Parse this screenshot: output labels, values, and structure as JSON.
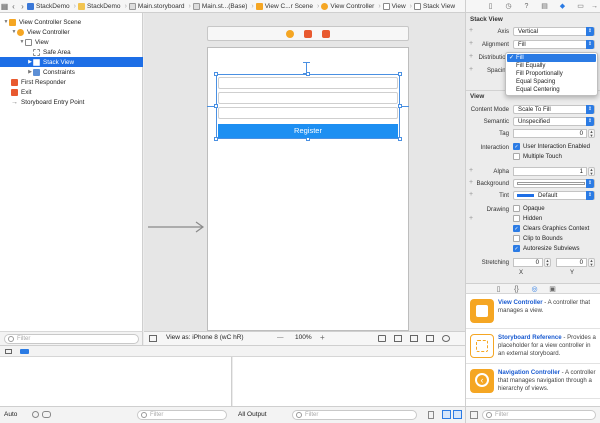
{
  "jumpbar": {
    "crumbs": [
      "StackDemo",
      "StackDemo",
      "Main.storyboard",
      "Main.st...(Base)",
      "View C...r Scene",
      "View Controller",
      "View",
      "Stack View"
    ]
  },
  "outline": {
    "items": [
      {
        "label": "View Controller Scene",
        "icon": "scene-icon"
      },
      {
        "label": "View Controller",
        "icon": "view-controller-icon"
      },
      {
        "label": "View",
        "icon": "view-icon"
      },
      {
        "label": "Safe Area",
        "icon": "safe-area-icon"
      },
      {
        "label": "Stack View",
        "icon": "stack-view-icon"
      },
      {
        "label": "Constraints",
        "icon": "constraints-icon"
      },
      {
        "label": "First Responder",
        "icon": "first-responder-icon"
      },
      {
        "label": "Exit",
        "icon": "exit-icon"
      },
      {
        "label": "Storyboard Entry Point",
        "icon": "arrow-right-icon"
      }
    ],
    "filter_placeholder": "Filter"
  },
  "canvas": {
    "button_label": "Register",
    "view_as": "View as: iPhone 8 (wC hR)",
    "zoom": "100%",
    "zoom_minus": "—",
    "zoom_plus": "+"
  },
  "inspector": {
    "stack_view": {
      "title": "Stack View",
      "axis_label": "Axis",
      "axis_value": "Vertical",
      "alignment_label": "Alignment",
      "alignment_value": "Fill",
      "distribution_label": "Distribution",
      "spacing_label": "Spacing",
      "menu": [
        "Fill",
        "Fill Equally",
        "Fill Proportionally",
        "Equal Spacing",
        "Equal Centering"
      ],
      "menu_selected": "Fill"
    },
    "view": {
      "title": "View",
      "content_mode_label": "Content Mode",
      "content_mode_value": "Scale To Fill",
      "semantic_label": "Semantic",
      "semantic_value": "Unspecified",
      "tag_label": "Tag",
      "tag_value": "0",
      "interaction_label": "Interaction",
      "user_interaction": "User Interaction Enabled",
      "multiple_touch": "Multiple Touch",
      "alpha_label": "Alpha",
      "alpha_value": "1",
      "background_label": "Background",
      "tint_label": "Tint",
      "tint_value": "Default",
      "drawing_label": "Drawing",
      "opaque": "Opaque",
      "hidden": "Hidden",
      "clears_graphics": "Clears Graphics Context",
      "clip_to_bounds": "Clip to Bounds",
      "autoresize": "Autoresize Subviews",
      "stretching_label": "Stretching",
      "stretch_x_value": "0",
      "stretch_y_value": "0",
      "x_label": "X",
      "y_label": "Y"
    }
  },
  "library": {
    "items": [
      {
        "title": "View Controller",
        "desc": " - A controller that manages a view."
      },
      {
        "title": "Storyboard Reference",
        "desc": " - Provides a placeholder for a view controller in an external storyboard."
      },
      {
        "title": "Navigation Controller",
        "desc": " - A controller that manages navigation through a hierarchy of views."
      }
    ],
    "filter_placeholder": "Filter"
  },
  "debug": {
    "auto_label": "Auto",
    "filter_placeholder": "Filter",
    "output_label": "All Output"
  },
  "colors": {
    "selection": "#1d6ee6",
    "accent": "#2b7be4",
    "button": "#1d8ff2"
  }
}
